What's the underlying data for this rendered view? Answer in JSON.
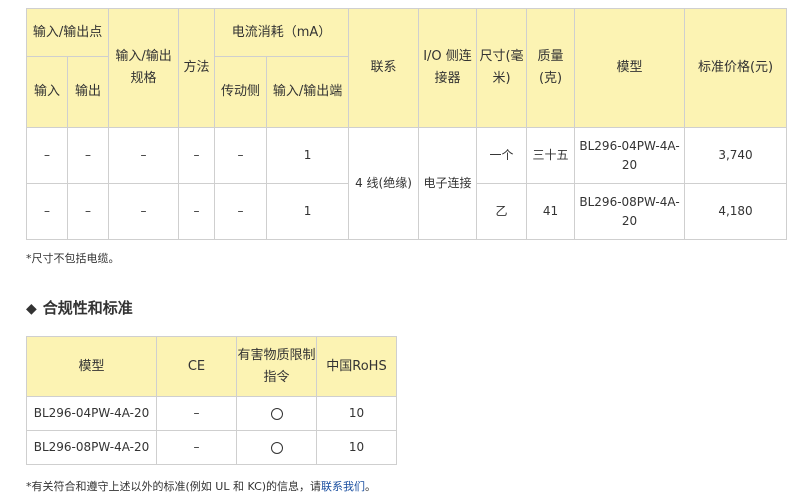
{
  "spec_table": {
    "headers": {
      "io_points": "输入/输出点",
      "input": "输入",
      "output": "输出",
      "io_spec": "输入/输出规格",
      "method": "方法",
      "current": "电流消耗（mA）",
      "drive_side": "传动侧",
      "io_end": "输入/输出端",
      "connection": "联系",
      "io_connector": "I/O 侧连接器",
      "size": "尺寸(毫米)",
      "mass": "质量(克)",
      "model": "模型",
      "price": "标准价格(元)"
    },
    "rows": [
      {
        "input": "–",
        "output": "–",
        "io_spec": "–",
        "method": "–",
        "drive_side": "–",
        "io_end": "1",
        "size": "一个",
        "mass": "三十五",
        "model": "BL296-04PW-4A-20",
        "price": "3,740"
      },
      {
        "input": "–",
        "output": "–",
        "io_spec": "–",
        "method": "–",
        "drive_side": "–",
        "io_end": "1",
        "size": "乙",
        "mass": "41",
        "model": "BL296-08PW-4A-20",
        "price": "4,180"
      }
    ],
    "connection_value": "4 线(绝缘)",
    "io_connector_value": "电子连接"
  },
  "note_size": "*尺寸不包括电缆。",
  "section_title": "合规性和标准",
  "rohs_table": {
    "headers": {
      "model": "模型",
      "ce": "CE",
      "hazardous": "有害物质限制指令",
      "china_rohs": "中国RoHS"
    },
    "rows": [
      {
        "model": "BL296-04PW-4A-20",
        "ce": "–",
        "china_rohs": "10"
      },
      {
        "model": "BL296-08PW-4A-20",
        "ce": "–",
        "china_rohs": "10"
      }
    ]
  },
  "note_standards": "*有关符合和遵守上述以外的标准(例如 UL 和 KC)的信息，请",
  "contact_link": "联系我们",
  "note_end": "。"
}
